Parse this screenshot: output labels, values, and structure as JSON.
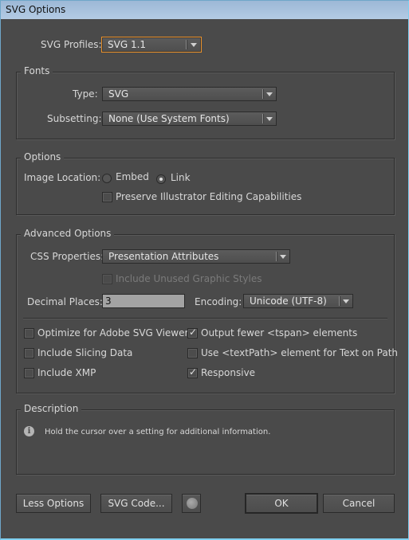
{
  "window": {
    "title": "SVG Options"
  },
  "profiles": {
    "label": "SVG Profiles:",
    "value": "SVG 1.1"
  },
  "fonts": {
    "legend": "Fonts",
    "type_label": "Type:",
    "type_value": "SVG",
    "subsetting_label": "Subsetting:",
    "subsetting_value": "None (Use System Fonts)"
  },
  "options": {
    "legend": "Options",
    "image_location_label": "Image Location:",
    "embed_label": "Embed",
    "embed_selected": false,
    "link_label": "Link",
    "link_selected": true,
    "preserve_label": "Preserve Illustrator Editing Capabilities",
    "preserve_checked": false
  },
  "advanced": {
    "legend": "Advanced Options",
    "css_label": "CSS Properties:",
    "css_value": "Presentation Attributes",
    "unused_styles_label": "Include Unused Graphic Styles",
    "unused_styles_checked": false,
    "unused_styles_enabled": false,
    "decimal_label": "Decimal Places:",
    "decimal_value": "3",
    "encoding_label": "Encoding:",
    "encoding_value": "Unicode (UTF-8)",
    "checkboxes": [
      {
        "label": "Optimize for Adobe SVG Viewer",
        "checked": false
      },
      {
        "label": "Include Slicing Data",
        "checked": false
      },
      {
        "label": "Include XMP",
        "checked": false
      },
      {
        "label": "Output fewer <tspan> elements",
        "checked": true
      },
      {
        "label": "Use <textPath> element for Text on Path",
        "checked": false
      },
      {
        "label": "Responsive",
        "checked": true
      }
    ]
  },
  "description": {
    "legend": "Description",
    "text": "Hold the cursor over a setting for additional information."
  },
  "buttons": {
    "less_options": "Less Options",
    "svg_code": "SVG Code...",
    "ok": "OK",
    "cancel": "Cancel"
  },
  "colors": {
    "focus": "#e8902a",
    "background": "#4a4a4a"
  }
}
